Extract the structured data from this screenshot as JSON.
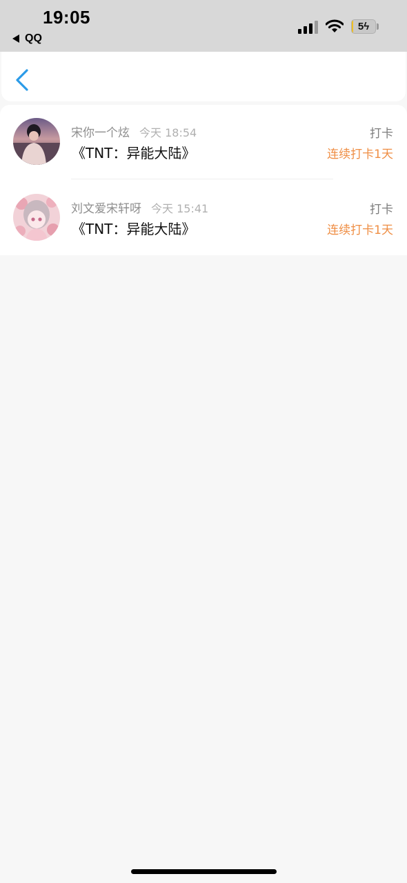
{
  "status_bar": {
    "time": "19:05",
    "back_app": "QQ",
    "battery_level": "5",
    "battery_fraction": 0.05,
    "signal_icon": "cellular-signal-icon",
    "wifi_icon": "wifi-icon"
  },
  "nav": {
    "back_icon": "chevron-left-icon"
  },
  "checkins": [
    {
      "name": "宋你一个炫",
      "time": "今天 18:54",
      "title": "《TNT：异能大陆》",
      "action": "打卡",
      "streak": "连续打卡1天"
    },
    {
      "name": "刘文爱宋轩呀",
      "time": "今天 15:41",
      "title": "《TNT：异能大陆》",
      "action": "打卡",
      "streak": "连续打卡1天"
    }
  ],
  "colors": {
    "accent_blue": "#2b9be8",
    "streak_orange": "#ef8e44",
    "page_background": "#f7f7f7"
  }
}
